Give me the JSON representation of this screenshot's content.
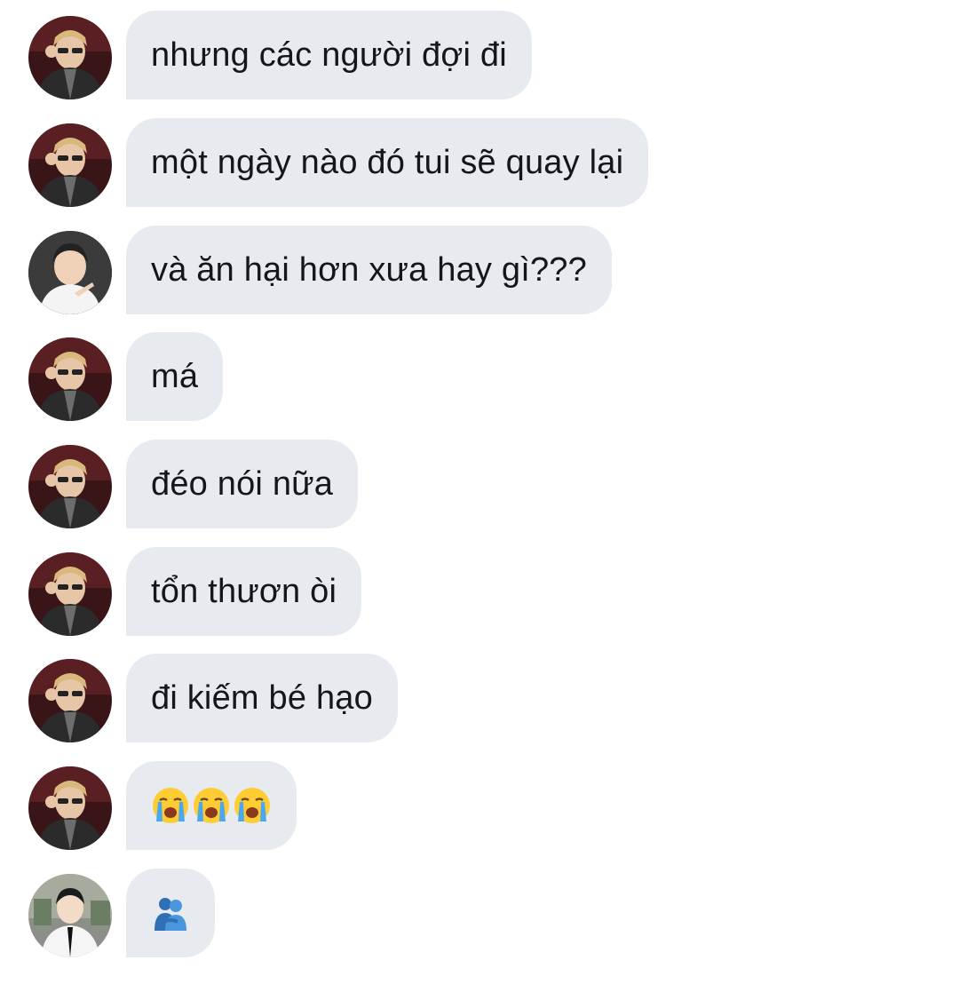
{
  "conversation": {
    "messages": [
      {
        "sender": "avatar-a",
        "text": "nhưng các người đợi đi"
      },
      {
        "sender": "avatar-a",
        "text": "một ngày nào đó tui sẽ quay lại"
      },
      {
        "sender": "avatar-b",
        "text": "và ăn hại hơn xưa hay gì???"
      },
      {
        "sender": "avatar-a",
        "text": "má"
      },
      {
        "sender": "avatar-a",
        "text": "đéo nói nữa"
      },
      {
        "sender": "avatar-a",
        "text": "tổn thươn òi"
      },
      {
        "sender": "avatar-a",
        "text": "đi kiếm bé hạo"
      },
      {
        "sender": "avatar-a",
        "emojis": [
          "loudly-crying-face-icon",
          "loudly-crying-face-icon",
          "loudly-crying-face-icon"
        ]
      },
      {
        "sender": "avatar-c",
        "emojis": [
          "people-hugging-icon"
        ]
      }
    ]
  },
  "colors": {
    "bubble_background": "#e7ebf0",
    "text": "#14171a",
    "page_background": "#ffffff"
  }
}
